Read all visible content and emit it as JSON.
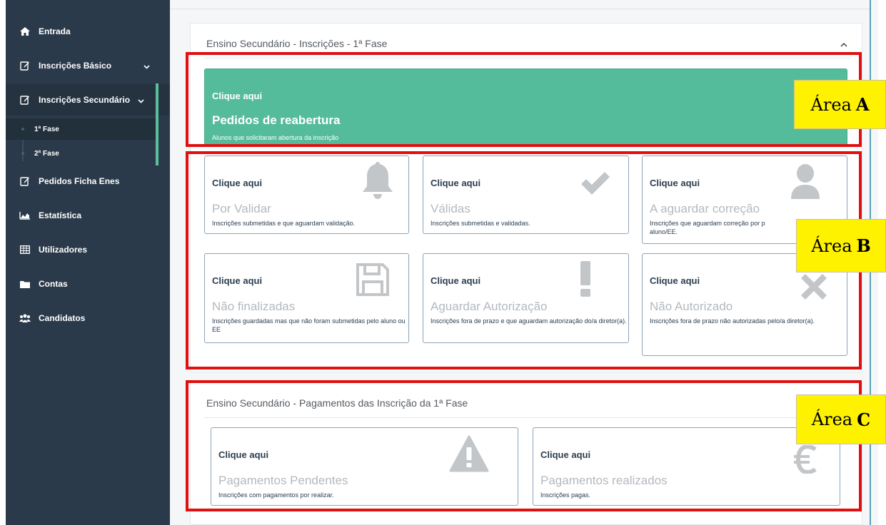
{
  "sidebar": {
    "items": [
      {
        "label": "Entrada",
        "icon": "home-icon"
      },
      {
        "label": "Inscrições Básico",
        "icon": "edit-icon"
      },
      {
        "label": "Inscrições Secundário",
        "icon": "edit-icon"
      },
      {
        "label": "Pedidos Ficha Enes",
        "icon": "edit-icon"
      },
      {
        "label": "Estatística",
        "icon": "area-chart-icon"
      },
      {
        "label": "Utilizadores",
        "icon": "table-icon"
      },
      {
        "label": "Contas",
        "icon": "folder-icon"
      },
      {
        "label": "Candidatos",
        "icon": "users-icon"
      }
    ],
    "subitems": [
      {
        "label": "1ª Fase"
      },
      {
        "label": "2ª Fase"
      }
    ]
  },
  "section1": {
    "title": "Ensino Secundário - Inscrições - 1ª Fase",
    "reopen_card": {
      "cta": "Clique aqui",
      "title": "Pedidos de reabertura",
      "desc": "Alunos que solicitaram abertura da inscrição"
    },
    "cards": [
      {
        "cta": "Clique aqui",
        "title": "Por Validar",
        "desc": "Inscrições submetidas e que aguardam validação.",
        "icon": "bell-icon"
      },
      {
        "cta": "Clique aqui",
        "title": "Válidas",
        "desc": "Inscrições submetidas e validadas.",
        "icon": "check-icon"
      },
      {
        "cta": "Clique aqui",
        "title": "A aguardar correção",
        "desc": "Inscrições que aguardam correção por p",
        "desc2": "aluno/EE.",
        "icon": "user-icon"
      },
      {
        "cta": "Clique aqui",
        "title": "Não finalizadas",
        "desc": "Inscrições guardadas mas que não foram submetidas pelo aluno ou EE",
        "icon": "save-icon"
      },
      {
        "cta": "Clique aqui",
        "title": "Aguardar Autorização",
        "desc": "Inscrições fora de prazo e que aguardam autorização do/a diretor(a).",
        "icon": "exclamation-icon"
      },
      {
        "cta": "Clique aqui",
        "title": "Não Autorizado",
        "desc": "Inscrições fora de prazo não autorizadas pelo/a diretor(a).",
        "icon": "x-icon"
      }
    ]
  },
  "section2": {
    "title": "Ensino Secundário - Pagamentos das Inscrição da 1ª Fase",
    "cards": [
      {
        "cta": "Clique aqui",
        "title": "Pagamentos Pendentes",
        "desc": "Inscrições com pagamentos por realizar.",
        "icon": "warning-icon"
      },
      {
        "cta": "Clique aqui",
        "title": "Pagamentos realizados",
        "desc": "Inscrições pagas.",
        "icon": "euro-icon"
      }
    ]
  },
  "annotations": {
    "area_word": "Área",
    "a": "A",
    "b": "B",
    "c": "C"
  },
  "colors": {
    "sidebar": "#2b3a4a",
    "accent": "#55bc9b",
    "annotation_border": "#e01010",
    "annotation_label": "#fff200"
  }
}
